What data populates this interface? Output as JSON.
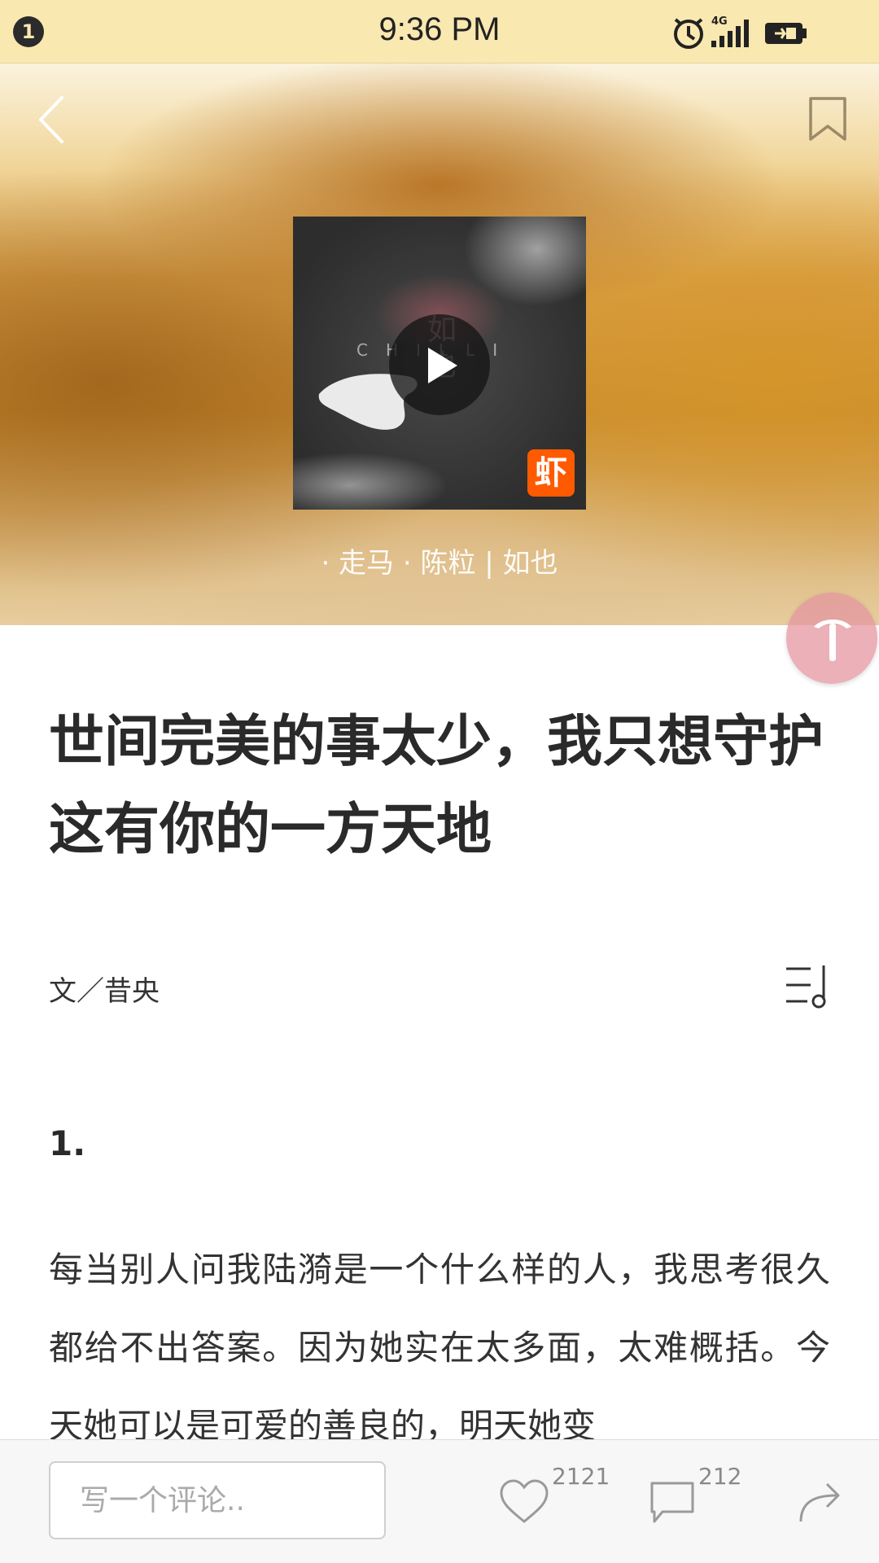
{
  "status_bar": {
    "notification_count": "1",
    "time": "9:36 PM",
    "network": "4G",
    "icons": [
      "alarm-icon",
      "signal-icon",
      "battery-icon"
    ]
  },
  "hero": {
    "icons": [
      "back-arrow-icon",
      "bookmark-icon",
      "play-icon"
    ],
    "album_cover": {
      "letters": "CHILLI",
      "chinese_title": "如也",
      "brand_mark": "虾"
    },
    "song_caption": "· 走马 · 陈粒 | 如也"
  },
  "floating_button": {
    "icon": "pickaxe-icon"
  },
  "article": {
    "title": "世间完美的事太少，我只想守护这有你的一方天地",
    "author": "文／昔央",
    "section_number": "1.",
    "body": "每当别人问我陆漪是一个什么样的人，我思考很久都给不出答案。因为她实在太多面，太难概括。今天她可以是可爱的善良的，明天她变"
  },
  "bottom_bar": {
    "comment_placeholder": "写一个评论..",
    "like_count": "2121",
    "comment_count": "212",
    "icons": [
      "heart-icon",
      "comment-icon",
      "share-icon"
    ]
  },
  "colors": {
    "status_bar_bg": "#f9e8b0",
    "brand_orange": "#ff5a00",
    "float_button": "#e496a0",
    "title_text": "#2a2a2a"
  }
}
